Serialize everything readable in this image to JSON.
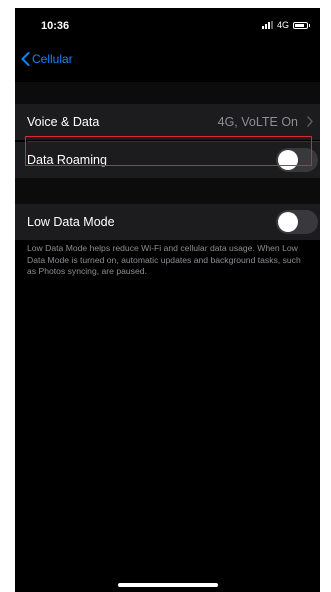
{
  "status_bar": {
    "time": "10:36",
    "network": "4G"
  },
  "nav": {
    "back_label": "Cellular"
  },
  "rows": {
    "voice_data": {
      "label": "Voice & Data",
      "value": "4G, VoLTE On"
    },
    "data_roaming": {
      "label": "Data Roaming",
      "enabled": false
    },
    "low_data_mode": {
      "label": "Low Data Mode",
      "enabled": false
    }
  },
  "footnote": "Low Data Mode helps reduce Wi-Fi and cellular data usage. When Low Data Mode is turned on, automatic updates and background tasks, such as Photos syncing, are paused.",
  "colors": {
    "accent": "#0a84ff",
    "highlight": "#e0252b",
    "toggle_off": "#39393d",
    "row_bg": "#1c1c1e"
  },
  "icons": {
    "back": "chevron-left-icon",
    "disclosure": "chevron-right-icon",
    "signal": "signal-bars-icon",
    "battery": "battery-icon"
  }
}
